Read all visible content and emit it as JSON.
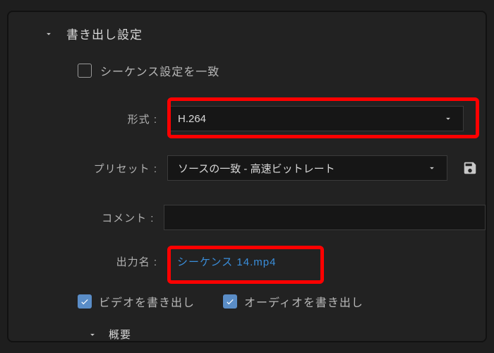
{
  "section": {
    "title": "書き出し設定",
    "matchSequence": {
      "label": "シーケンス設定を一致",
      "checked": false
    },
    "formatLabel": "形式 :",
    "formatValue": "H.264",
    "presetLabel": "プリセット :",
    "presetValue": "ソースの一致 - 高速ビットレート",
    "commentLabel": "コメント :",
    "commentValue": "",
    "outputLabel": "出力名 :",
    "outputValue": "シーケンス 14.mp4",
    "exportVideo": {
      "label": "ビデオを書き出し",
      "checked": true
    },
    "exportAudio": {
      "label": "オーディオを書き出し",
      "checked": true
    },
    "summaryTitle": "概要"
  }
}
